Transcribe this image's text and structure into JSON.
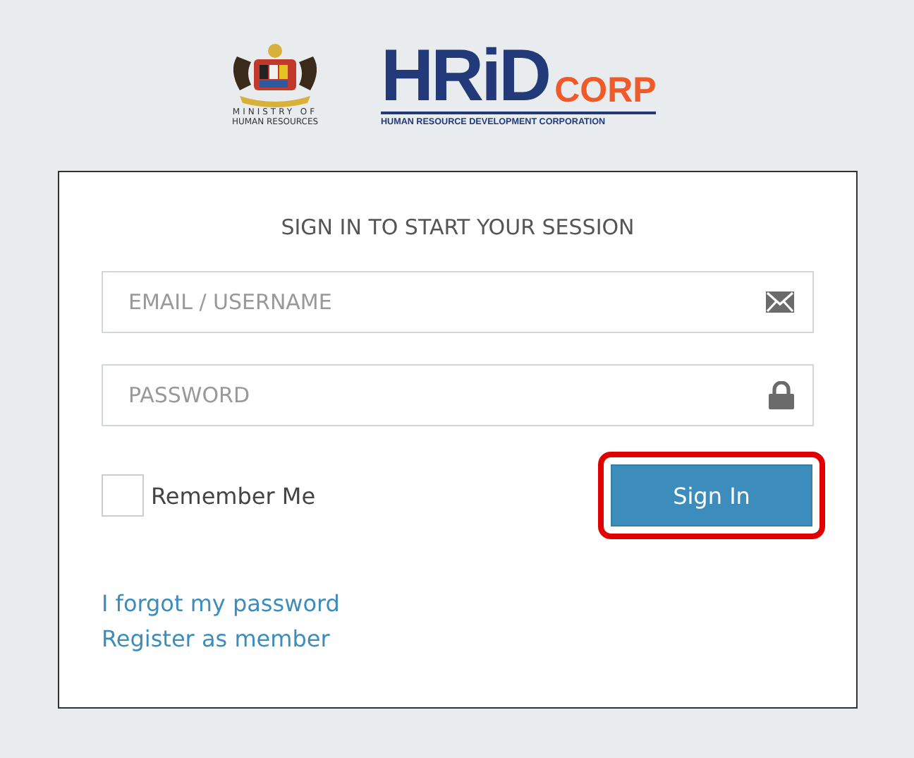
{
  "ministry_logo": {
    "lines": [
      "MINISTRY OF",
      "HUMAN RESOURCES"
    ]
  },
  "brand_logo": {
    "wordmark": "HRiD",
    "suffix": "CORP",
    "tagline": "HUMAN RESOURCE DEVELOPMENT CORPORATION"
  },
  "login_box": {
    "heading": "SIGN IN TO START YOUR SESSION",
    "fields": [
      {
        "placeholder": "EMAIL / USERNAME",
        "kind": "email"
      },
      {
        "placeholder": "PASSWORD",
        "kind": "password"
      }
    ],
    "remember_me": {
      "label": "Remember Me",
      "checked": false
    },
    "sign_in_button": {
      "label": "Sign In",
      "highlighted": true
    },
    "links": [
      "I forgot my password",
      "Register as member"
    ]
  }
}
